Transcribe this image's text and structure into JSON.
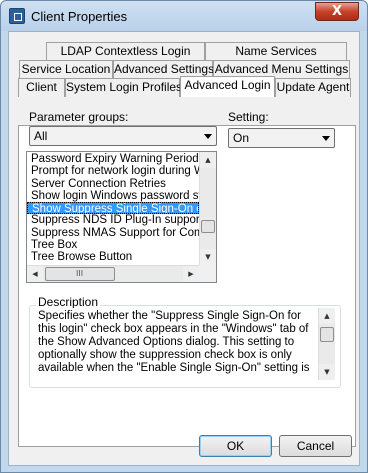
{
  "window": {
    "title": "Client Properties",
    "close_label": "X"
  },
  "tabs": {
    "row1": [
      "LDAP Contextless Login",
      "Name Services"
    ],
    "row2": [
      "Service Location",
      "Advanced Settings",
      "Advanced Menu Settings"
    ],
    "row3": [
      "Client",
      "System Login Profiles",
      "Advanced Login",
      "Update Agent"
    ],
    "active": "Advanced Login"
  },
  "parameter_groups": {
    "label": "Parameter groups:",
    "value": "All"
  },
  "setting": {
    "label": "Setting:",
    "value": "On"
  },
  "parameters": {
    "items": [
      "Password Expiry Warning Period",
      "Prompt for network login during W",
      "Server Connection Retries",
      "Show login Windows password syn",
      "Show Suppress Single Sign-On che",
      "Suppress NDS ID Plug-In support",
      "Suppress NMAS Support for Comp",
      "Tree Box",
      "Tree Browse Button"
    ],
    "selected_index": 4,
    "hscroll_grip": "III"
  },
  "description": {
    "label": "Description",
    "text": "Specifies whether the \"Suppress Single Sign-On for this login\" check box appears in the \"Windows\" tab of the Show Advanced Options dialog.  This setting to optionally show the suppression check box is only available when the \"Enable Single Sign-On\" setting is"
  },
  "buttons": {
    "ok": "OK",
    "cancel": "Cancel"
  }
}
